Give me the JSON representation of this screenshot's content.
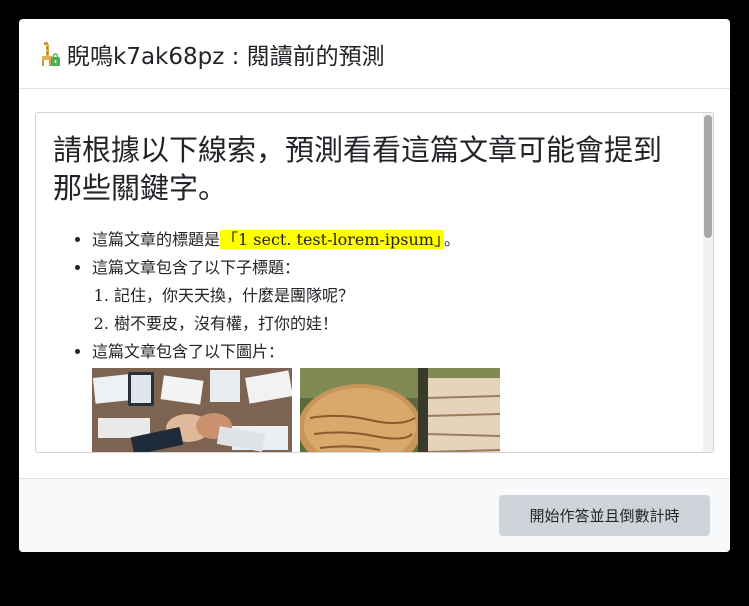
{
  "header": {
    "title": "睨鳴k7ak68pz : 閱讀前的預測",
    "icon": "giraffe-lock-icon"
  },
  "content": {
    "heading": "請根據以下線索，預測看看這篇文章可能會提到那些關鍵字。",
    "title_clue_prefix": "這篇文章的標題是",
    "title_clue_value": "「1 sect. test-lorem-ipsum」",
    "title_clue_suffix": "。",
    "subtitles_clue": "這篇文章包含了以下子標題：",
    "subtitles": [
      "記住，你天天換，什麼是團隊呢？",
      "樹不要皮，沒有權，打你的娃！"
    ],
    "images_clue": "這篇文章包含了以下圖片：",
    "images": [
      "teamwork-fist-bump-image",
      "tree-bark-image"
    ]
  },
  "footer": {
    "start_button_label": "開始作答並且倒數計時"
  },
  "colors": {
    "highlight": "#ffff00",
    "button_bg": "#ced4da",
    "footer_bg": "#f8f9fa"
  }
}
